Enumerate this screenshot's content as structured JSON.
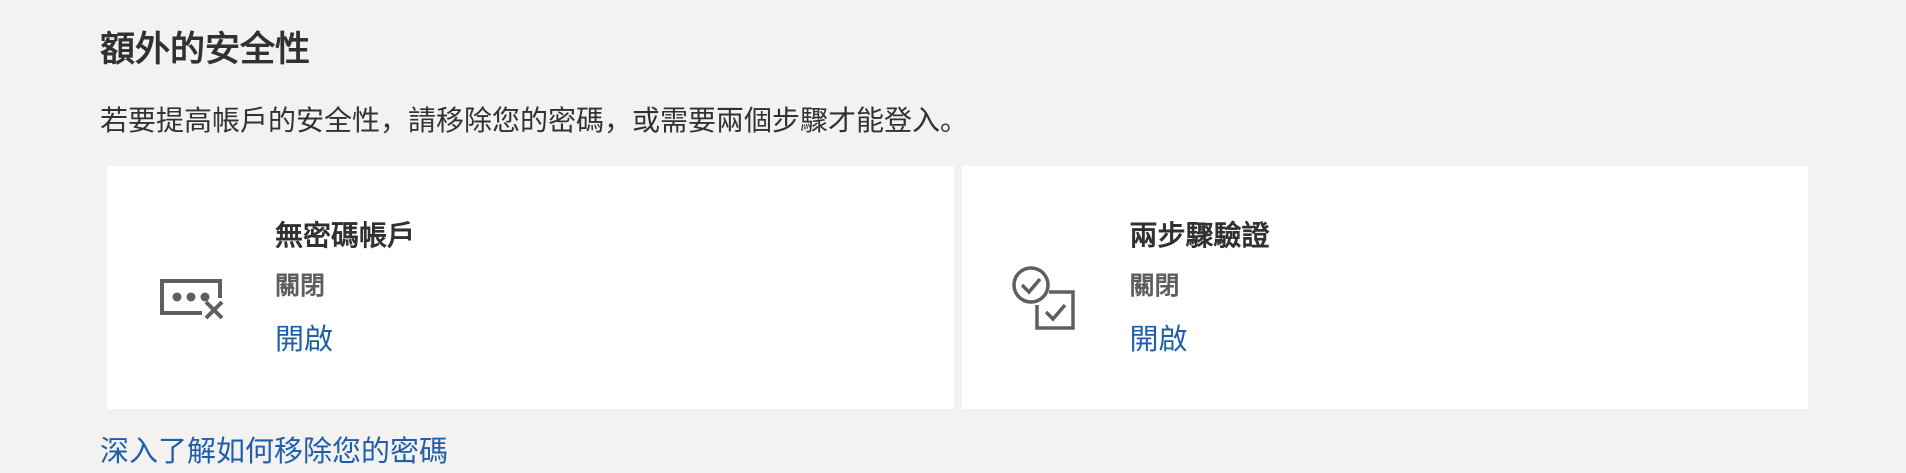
{
  "section": {
    "title": "額外的安全性",
    "description": "若要提高帳戶的安全性，請移除您的密碼，或需要兩個步驟才能登入。"
  },
  "cards": [
    {
      "icon": "password-remove-icon",
      "title": "無密碼帳戶",
      "status": "關閉",
      "action": "開啟"
    },
    {
      "icon": "two-step-verification-icon",
      "title": "兩步驟驗證",
      "status": "關閉",
      "action": "開啟"
    }
  ],
  "learn_more_link": "深入了解如何移除您的密碼",
  "colors": {
    "background": "#f3f2f1",
    "card": "#ffffff",
    "text": "#323130",
    "muted": "#605e5c",
    "link": "#1f5faa",
    "icon": "#5f5f5f"
  }
}
